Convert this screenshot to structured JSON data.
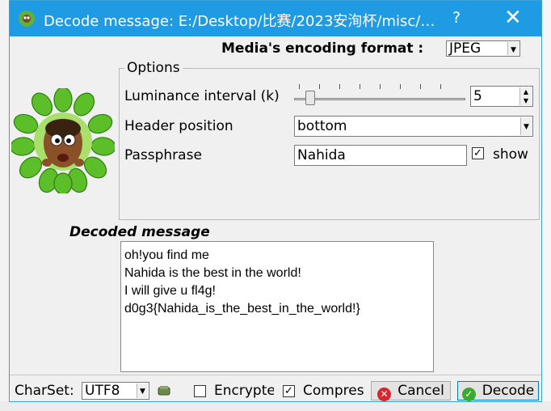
{
  "window": {
    "title": "Decode message: E:/Desktop/比赛/2023安洵杯/misc/…",
    "help_glyph": "?",
    "close_glyph": "✕"
  },
  "media": {
    "label": "Media's encoding format :",
    "value": "JPEG"
  },
  "options": {
    "legend": "Options",
    "luminance_label": "Luminance interval (k)",
    "luminance_value": "5",
    "header_label": "Header position",
    "header_value": "bottom",
    "passphrase_label": "Passphrase",
    "passphrase_value": "Nahida",
    "show_label": "show",
    "show_checked": true
  },
  "decoded": {
    "label": "Decoded message",
    "lines": [
      "oh!you find me",
      "Nahida is the best in the world!",
      "I will give u fl4g!",
      "d0g3{Nahida_is_the_best_in_the_world!}"
    ]
  },
  "bottom": {
    "charset_label": "CharSet:",
    "charset_value": "UTF8",
    "encrypted_label": "Encrypted",
    "compress_label": "Compres",
    "compress_checked": true,
    "cancel_label": "Cancel",
    "decode_label": "Decode"
  },
  "icons": [
    "app-icon",
    "mascot-image",
    "charset-edit-icon",
    "cancel-icon",
    "decode-icon"
  ],
  "colors": {
    "titlebar": "#1e9be3",
    "cancel": "#d8262c",
    "decode": "#3bab2e"
  }
}
